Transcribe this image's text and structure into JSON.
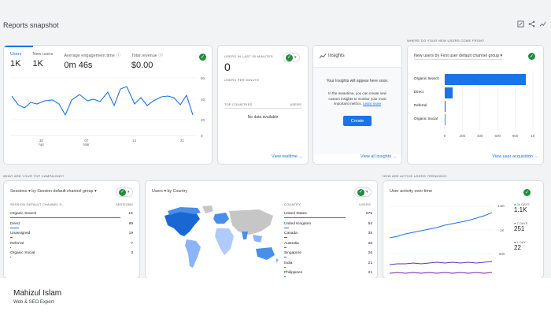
{
  "header": {
    "title": "Reports snapshot"
  },
  "colors": {
    "accent": "#1a73e8",
    "check": "#1e8e3e",
    "line2": "#7b1fa2"
  },
  "overview": {
    "metrics": [
      {
        "label": "Users",
        "value": "1K"
      },
      {
        "label": "New users",
        "value": "1K"
      },
      {
        "label": "Average engagement time",
        "value": "0m 46s"
      },
      {
        "label": "Total revenue",
        "value": "$0.00"
      }
    ],
    "y_ticks": [
      "60",
      "40",
      "20",
      "0"
    ],
    "x_ticks": [
      {
        "day": "30",
        "mon": "Apr"
      },
      {
        "day": "07",
        "mon": "Mar"
      },
      {
        "day": "14",
        "mon": ""
      },
      {
        "day": "21",
        "mon": ""
      }
    ]
  },
  "realtime": {
    "title": "USERS IN LAST 30 MINUTES",
    "value": "0",
    "per_minute": "USERS PER MINUTE",
    "col_country": "TOP COUNTRIES",
    "col_users": "USERS",
    "empty": "No data available",
    "link": "View realtime"
  },
  "insights": {
    "title": "Insights",
    "line1": "Your Insights will appear here soon.",
    "line2": "In the meantime, you can create new custom insights to monitor your most important metrics.",
    "learn_more": "Learn more",
    "create": "Create",
    "link": "View all insights"
  },
  "acquisition": {
    "section": "WHERE DO YOUR NEW USERS COME FROM?",
    "selector": "New users by First user default channel group",
    "link": "View user acquisition",
    "x_ticks": [
      "0",
      "200",
      "400",
      "600",
      "800",
      "1K"
    ]
  },
  "campaigns": {
    "section": "WHAT ARE YOUR TOP CAMPAIGNS?",
    "selector_a": "Sessions",
    "selector_b": "by Session default channel group",
    "col_channel": "SESSION DEFAULT CHANNEL G...",
    "col_sessions": "SESSIONS",
    "rows": [
      {
        "label": "Organic Search",
        "value": "1K",
        "frac": 1.0
      },
      {
        "label": "Direct",
        "value": "89",
        "frac": 0.08
      },
      {
        "label": "Unassigned",
        "value": "19",
        "frac": 0.02
      },
      {
        "label": "Referral",
        "value": "7",
        "frac": 0.01
      },
      {
        "label": "Organic Social",
        "value": "3",
        "frac": 0.005
      }
    ]
  },
  "country": {
    "selector_a": "Users",
    "selector_b": "by Country",
    "col_country": "COUNTRY",
    "col_users": "USERS",
    "rows": [
      {
        "label": "United States",
        "value": "675",
        "frac": 1.0
      },
      {
        "label": "United Kingdom",
        "value": "54",
        "frac": 0.08
      },
      {
        "label": "Canada",
        "value": "35",
        "frac": 0.05
      },
      {
        "label": "Australia",
        "value": "26",
        "frac": 0.04
      },
      {
        "label": "Singapore",
        "value": "26",
        "frac": 0.04
      },
      {
        "label": "India",
        "value": "21",
        "frac": 0.03
      },
      {
        "label": "Philippines",
        "value": "21",
        "frac": 0.03
      }
    ]
  },
  "trend": {
    "section": "HOW ARE ACTIVE USERS TRENDING?",
    "title": "User activity over time",
    "y_ticks": [
      "1.5K",
      "1K",
      "500"
    ],
    "stats": [
      {
        "label": "30 DAYS",
        "value": "1.1K",
        "color": "#1a73e8"
      },
      {
        "label": "7 DAYS",
        "value": "251",
        "color": "#1a73e8"
      },
      {
        "label": "1 DAY",
        "value": "22",
        "color": "#5e35b1"
      }
    ]
  },
  "author": {
    "name": "Mahizul Islam",
    "role": "Web & SEO Expert"
  }
}
